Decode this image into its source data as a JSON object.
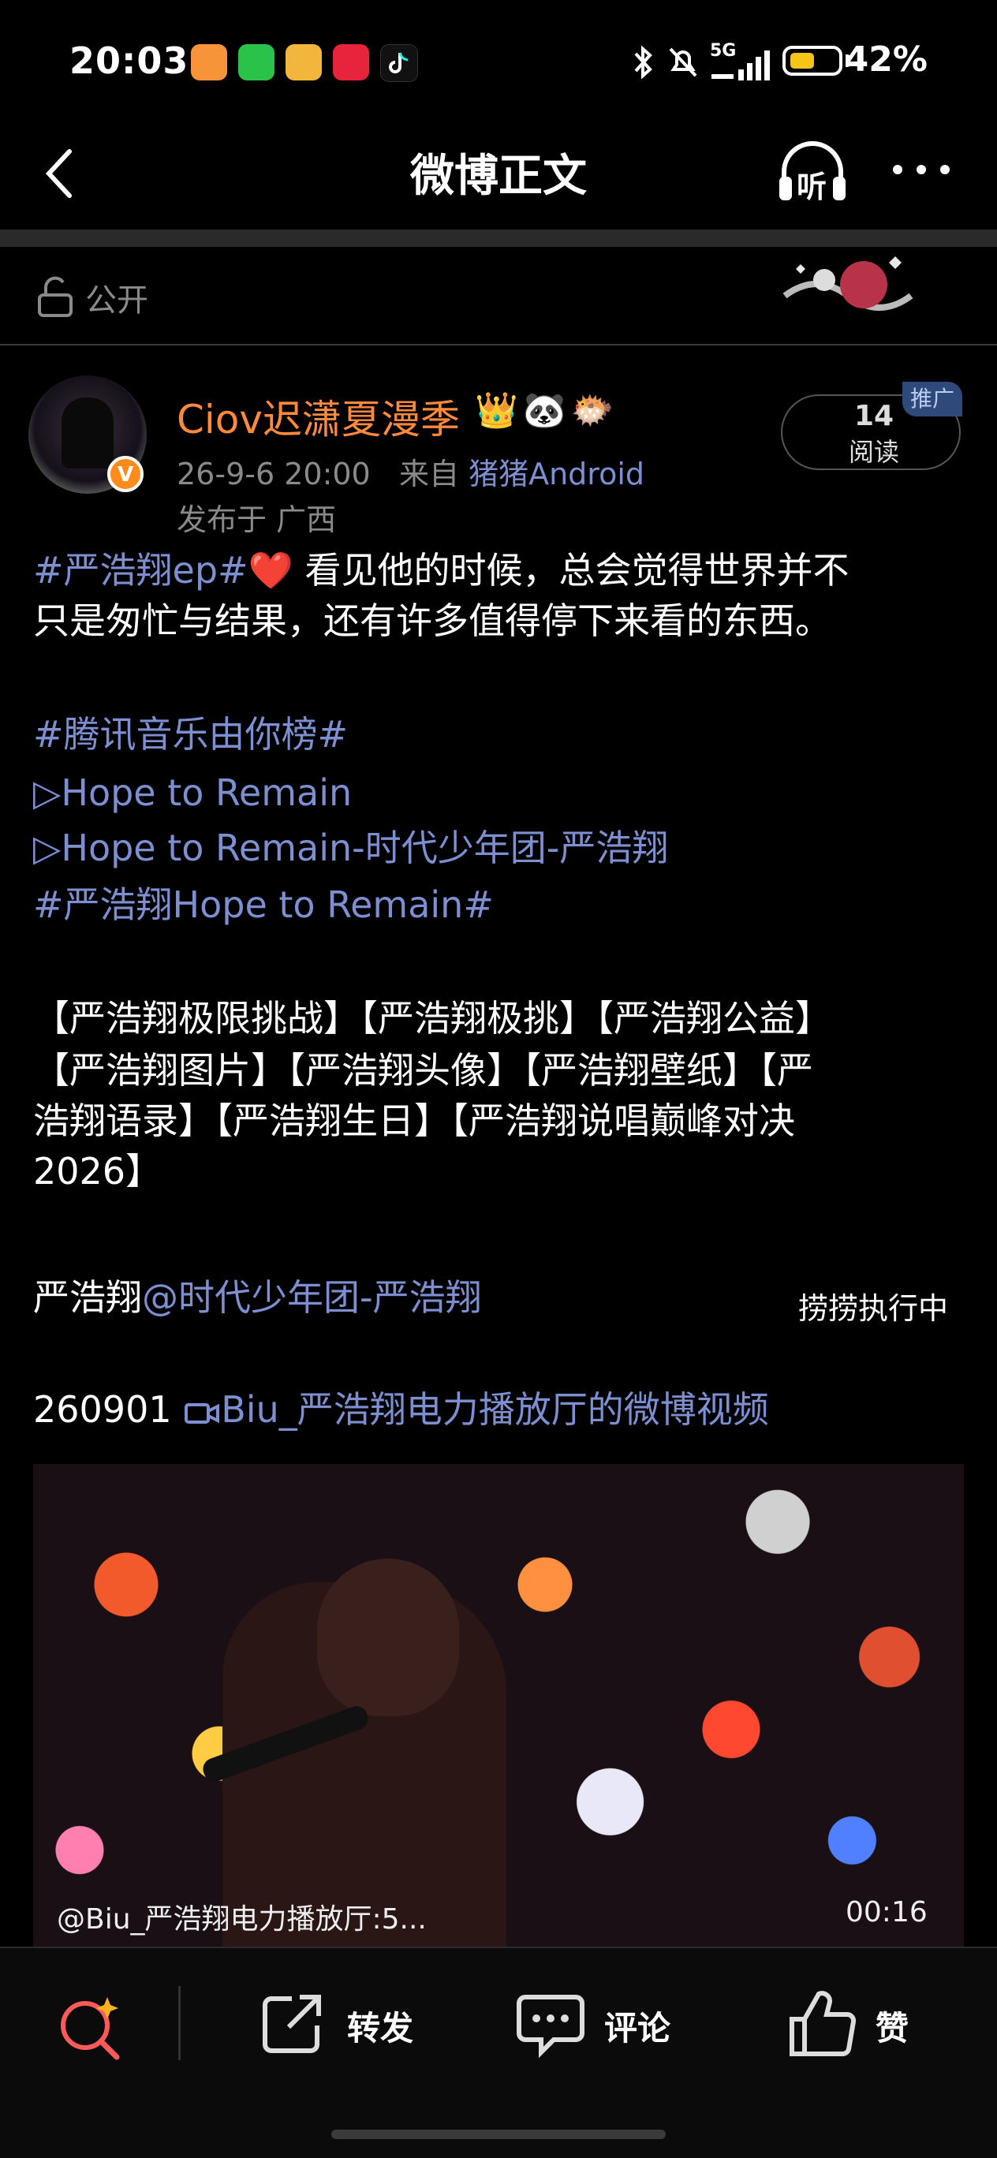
{
  "status_bar": {
    "time": "20:03",
    "battery_percent": "42%",
    "network": "5G"
  },
  "header": {
    "title": "微博正文",
    "listen_label": "听"
  },
  "visibility": {
    "label": "公开"
  },
  "post": {
    "author": "Ciov迟潇夏漫季",
    "author_badges": "👑🐼🐡",
    "verified_badge": "V",
    "time": "26-9-6 20:00",
    "from_prefix": "来自",
    "source": "猪猪Android",
    "location": "发布于 广西",
    "reads_count": "14",
    "reads_label": "阅读",
    "ad_tag": "推广",
    "lines": [
      {
        "parts": [
          {
            "text": "#严浩翔ep#",
            "link": true
          },
          {
            "text": "❤️ 看见他的时候，总会觉得世界并不",
            "link": false
          }
        ]
      },
      {
        "parts": [
          {
            "text": "只是匆忙与结果，还有许多值得停下来看的东西。",
            "link": false
          }
        ]
      },
      {
        "parts": [
          {
            "text": "#腾讯音乐由你榜#",
            "link": true
          }
        ]
      },
      {
        "parts": [
          {
            "text": "▷Hope to Remain",
            "link": true
          }
        ]
      },
      {
        "parts": [
          {
            "text": "▷Hope to Remain-时代少年团-严浩翔",
            "link": true
          }
        ]
      },
      {
        "parts": [
          {
            "text": "#严浩翔Hope to Remain#",
            "link": true
          }
        ]
      },
      {
        "parts": [
          {
            "text": "【严浩翔极限挑战】【严浩翔极挑】【严浩翔公益】",
            "link": false
          }
        ]
      },
      {
        "parts": [
          {
            "text": "【严浩翔图片】【严浩翔头像】【严浩翔壁纸】【严",
            "link": false
          }
        ]
      },
      {
        "parts": [
          {
            "text": "浩翔语录】【严浩翔生日】【严浩翔说唱巅峰对决",
            "link": false
          }
        ]
      },
      {
        "parts": [
          {
            "text": "2026】",
            "link": false
          }
        ]
      },
      {
        "parts": [
          {
            "text": "严浩翔",
            "link": false
          },
          {
            "text": "@时代少年团-严浩翔",
            "link": true
          }
        ]
      },
      {
        "parts": [
          {
            "text": "260901 ",
            "link": false
          },
          {
            "text": "Biu_严浩翔电力播放厅的微博视频",
            "link": true
          }
        ]
      }
    ],
    "executing_label": "捞捞执行中",
    "video": {
      "caption": "@Biu_严浩翔电力播放厅:5...",
      "duration": "00:16"
    }
  },
  "bottom_bar": {
    "repost_label": "转发",
    "comment_label": "评论",
    "like_label": "赞"
  }
}
